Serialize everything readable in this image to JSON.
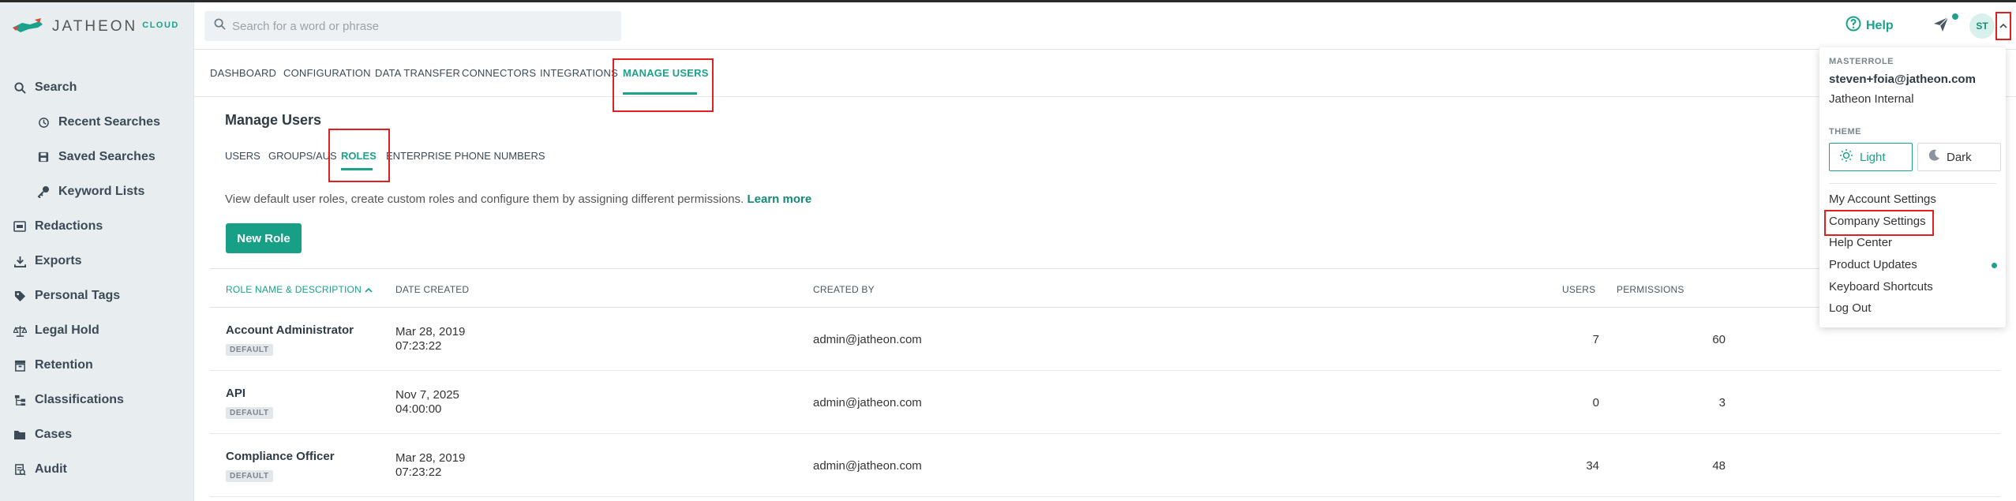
{
  "brand": {
    "name": "JATHEON",
    "cloud": "CLOUD",
    "accent": "#1aa38a"
  },
  "search": {
    "placeholder": "Search for a word or phrase"
  },
  "header": {
    "help_label": "Help",
    "avatar_initials": "ST"
  },
  "sidebar": {
    "items": [
      {
        "label": "Search",
        "icon": "search-icon"
      },
      {
        "label": "Recent Searches",
        "icon": "history-icon"
      },
      {
        "label": "Saved Searches",
        "icon": "save-icon"
      },
      {
        "label": "Keyword Lists",
        "icon": "key-icon"
      },
      {
        "label": "Redactions",
        "icon": "redaction-icon"
      },
      {
        "label": "Exports",
        "icon": "export-icon"
      },
      {
        "label": "Personal Tags",
        "icon": "tag-icon"
      },
      {
        "label": "Legal Hold",
        "icon": "scale-icon"
      },
      {
        "label": "Retention",
        "icon": "archive-icon"
      },
      {
        "label": "Classifications",
        "icon": "hierarchy-icon"
      },
      {
        "label": "Cases",
        "icon": "folder-icon"
      },
      {
        "label": "Audit",
        "icon": "audit-icon"
      }
    ]
  },
  "tabs": [
    "DASHBOARD",
    "CONFIGURATION",
    "DATA TRANSFER",
    "CONNECTORS",
    "INTEGRATIONS",
    "MANAGE USERS"
  ],
  "main": {
    "title": "Manage Users",
    "subtabs": [
      "USERS",
      "GROUPS/AUS",
      "ROLES",
      "ENTERPRISE PHONE NUMBERS"
    ],
    "description": "View default user roles, create custom roles and configure them by assigning different permissions.",
    "learn_more": "Learn more",
    "new_role_label": "New Role"
  },
  "table": {
    "headers": {
      "name": "ROLE NAME & DESCRIPTION",
      "date": "DATE CREATED",
      "creator": "CREATED BY",
      "users": "USERS",
      "perms": "PERMISSIONS"
    },
    "rows": [
      {
        "name": "Account Administrator",
        "badge": "DEFAULT",
        "date": "Mar 28, 2019",
        "time": "07:23:22",
        "creator": "admin@jatheon.com",
        "users": "7",
        "perms": "60"
      },
      {
        "name": "API",
        "badge": "DEFAULT",
        "date": "Nov 7, 2025",
        "time": "04:00:00",
        "creator": "admin@jatheon.com",
        "users": "0",
        "perms": "3"
      },
      {
        "name": "Compliance Officer",
        "badge": "DEFAULT",
        "date": "Mar 28, 2019",
        "time": "07:23:22",
        "creator": "admin@jatheon.com",
        "users": "34",
        "perms": "48"
      }
    ]
  },
  "dropdown": {
    "role_label": "MASTERROLE",
    "email": "steven+foia@jatheon.com",
    "org": "Jatheon Internal",
    "theme_label": "THEME",
    "light": "Light",
    "dark": "Dark",
    "items": [
      "My Account Settings",
      "Company Settings",
      "Help Center",
      "Product Updates",
      "Keyboard Shortcuts",
      "Log Out"
    ]
  }
}
